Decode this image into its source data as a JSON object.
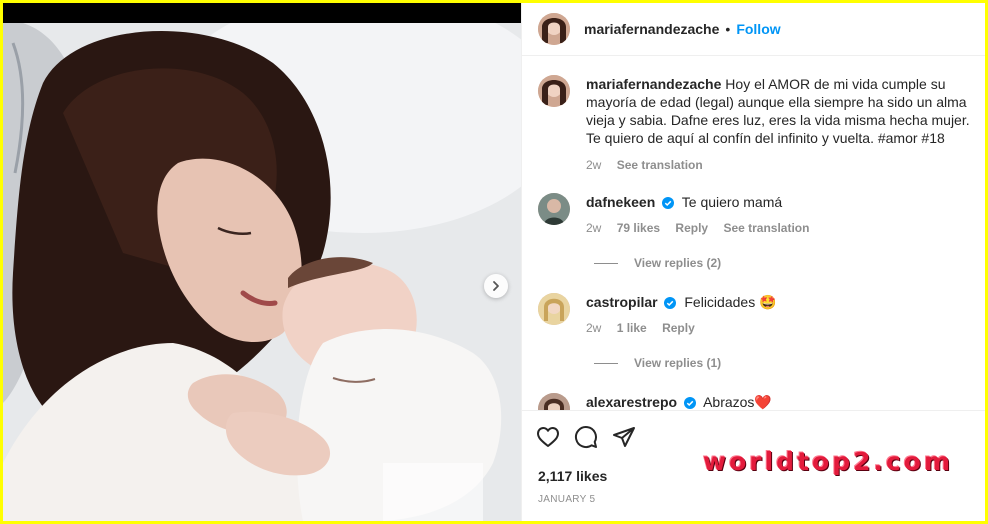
{
  "post": {
    "username": "mariafernandezache",
    "follow_label": "Follow",
    "separator": "•",
    "caption": "Hoy el AMOR de mi vida cumple su mayoría de edad (legal) aunque ella siempre ha sido un alma vieja y sabia. Dafne eres luz, eres la vida misma hecha mujer. Te quiero de aquí al confín del infinito y vuelta. #amor #18",
    "caption_time": "2w",
    "caption_translate": "See translation",
    "likes": "2,117 likes",
    "date": "JANUARY 5"
  },
  "comments": [
    {
      "user": "dafnekeen",
      "verified": true,
      "text": "Te quiero mamá",
      "time": "2w",
      "likes": "79 likes",
      "reply": "Reply",
      "translate": "See translation",
      "view_replies": "View replies (2)"
    },
    {
      "user": "castropilar",
      "verified": true,
      "text": "Felicidades 🤩",
      "time": "2w",
      "likes": "1 like",
      "reply": "Reply",
      "view_replies": "View replies (1)"
    },
    {
      "user": "alexarestrepo",
      "verified": true,
      "text": "Abrazos❤️"
    }
  ],
  "icons": {
    "like": "heart-icon",
    "comment": "comment-icon",
    "share": "share-icon",
    "next": "chevron-right-icon",
    "verified": "verified-badge-icon"
  },
  "colors": {
    "border": "#ffff00",
    "accent": "#0095f6",
    "watermark": "#e31b3c"
  },
  "watermark": "worldtop2.com"
}
